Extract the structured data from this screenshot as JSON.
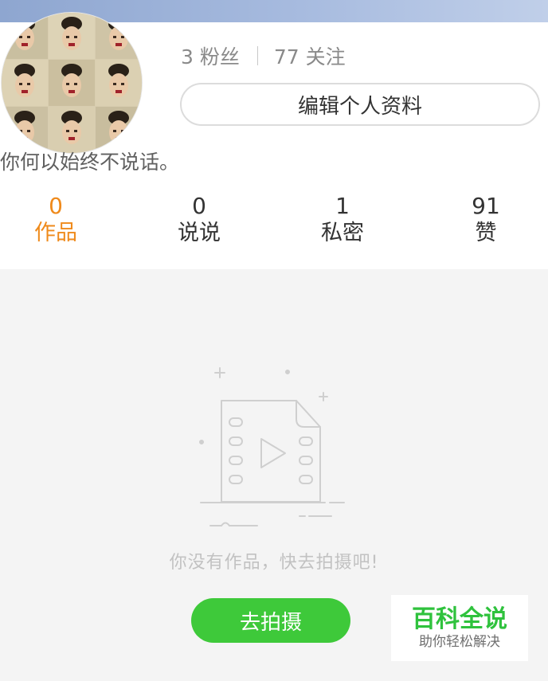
{
  "profile": {
    "fans_count": "3",
    "fans_label": "粉丝",
    "following_count": "77",
    "following_label": "关注",
    "edit_button": "编辑个人资料",
    "bio": "你何以始终不说话。"
  },
  "tabs": [
    {
      "count": "0",
      "label": "作品",
      "active": true
    },
    {
      "count": "0",
      "label": "说说",
      "active": false
    },
    {
      "count": "1",
      "label": "私密",
      "active": false
    },
    {
      "count": "91",
      "label": "赞",
      "active": false
    }
  ],
  "empty_state": {
    "message": "你没有作品，快去拍摄吧!",
    "button": "去拍摄",
    "icon": "video-file-icon"
  },
  "watermark": {
    "title": "百科全说",
    "subtitle": "助你轻松解决"
  },
  "colors": {
    "accent": "#ef8a1b",
    "button_green": "#3ec93a",
    "watermark_green": "#2fc23d"
  }
}
